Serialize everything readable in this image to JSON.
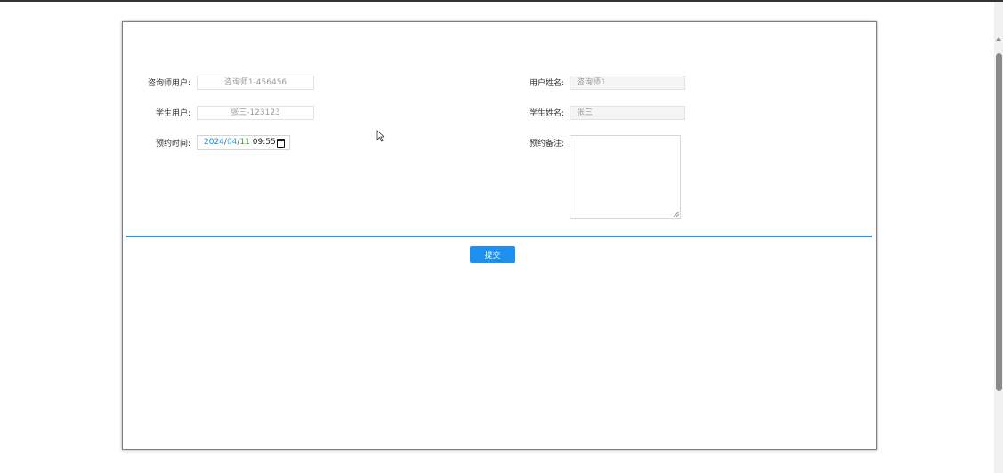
{
  "form": {
    "counselor_user_label": "咨询师用户:",
    "counselor_user_value": "咨询师1-456456",
    "student_user_label": "学生用户:",
    "student_user_value": "张三-123123",
    "appointment_time_label": "预约时间:",
    "appointment_time": {
      "year": "2024",
      "month": "04",
      "day": "11",
      "time": "09:55"
    },
    "user_name_label": "用户姓名:",
    "user_name_value": "咨询师1",
    "student_name_label": "学生姓名:",
    "student_name_value": "张三",
    "remark_label": "预约备注:",
    "remark_value": "",
    "submit_label": "提交"
  },
  "colors": {
    "accent": "#1e90f0",
    "divider": "#2b95d9"
  }
}
